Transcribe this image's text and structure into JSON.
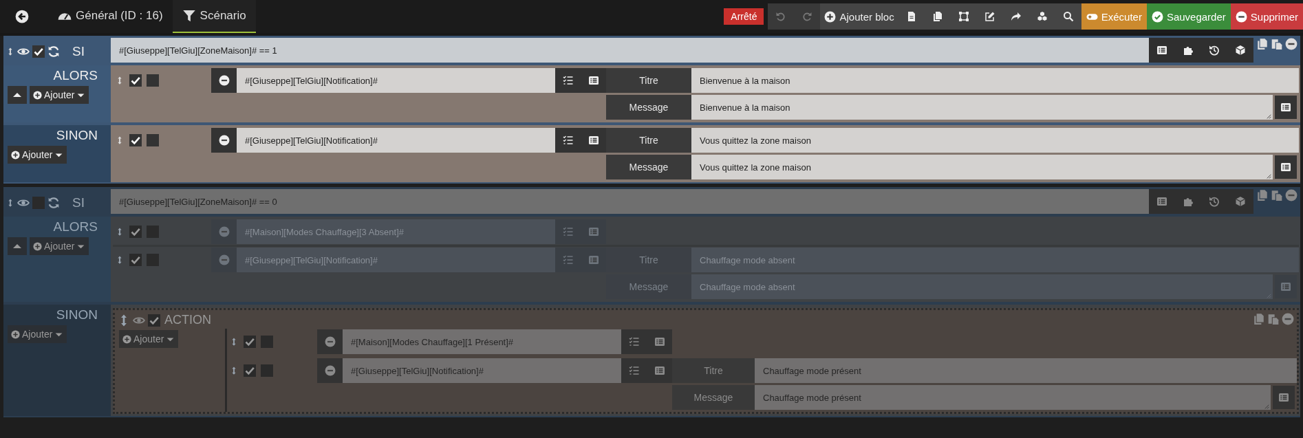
{
  "tabs": [
    {
      "kind": "general",
      "label": "Général (ID : 16)",
      "selected": false
    },
    {
      "kind": "scenario",
      "label": "Scénario",
      "selected": true
    }
  ],
  "status": "Arrêté",
  "history_buttons": [
    {
      "kind": "undo",
      "disabled": true
    },
    {
      "kind": "redo",
      "disabled": true
    }
  ],
  "add_block": "Ajouter bloc",
  "main_buttons": [
    {
      "kind": "execute",
      "label": "Exécuter"
    },
    {
      "kind": "save",
      "label": "Sauvegarder"
    },
    {
      "kind": "delete",
      "label": "Supprimer"
    }
  ],
  "blocks": [
    {
      "kind": "if",
      "keyword": "SI",
      "enabled": true,
      "condition": "#[Giuseppe][TelGiu][ZoneMaison]# == 1",
      "branches": [
        {
          "kind": "then",
          "label": "ALORS",
          "collapse_button": true,
          "add_label": "Ajouter",
          "items": [
            {
              "kind": "action",
              "enabled": true,
              "parallel": false,
              "expression": "#[Giuseppe][TelGiu][Notification]#",
              "options": [
                {
                  "kind": "line",
                  "label": "Titre",
                  "value": "Bienvenue à la maison"
                },
                {
                  "kind": "text",
                  "label": "Message",
                  "value": "Bienvenue à la maison"
                }
              ]
            }
          ]
        },
        {
          "kind": "else",
          "label": "SINON",
          "collapse_button": false,
          "add_label": "Ajouter",
          "items": [
            {
              "kind": "action",
              "enabled": true,
              "parallel": false,
              "expression": "#[Giuseppe][TelGiu][Notification]#",
              "options": [
                {
                  "kind": "line",
                  "label": "Titre",
                  "value": "Vous quittez la zone maison"
                },
                {
                  "kind": "text",
                  "label": "Message",
                  "value": "Vous quittez la zone maison"
                }
              ]
            }
          ]
        }
      ]
    },
    {
      "kind": "if",
      "keyword": "SI",
      "enabled": false,
      "condition": "#[Giuseppe][TelGiu][ZoneMaison]# == 0",
      "branches": [
        {
          "kind": "then",
          "label": "ALORS",
          "collapse_button": true,
          "add_label": "Ajouter",
          "items": [
            {
              "kind": "action",
              "enabled": true,
              "parallel": false,
              "expression": "#[Maison][Modes Chauffage][3 Absent]#"
            },
            {
              "kind": "action",
              "enabled": true,
              "parallel": false,
              "expression": "#[Giuseppe][TelGiu][Notification]#",
              "options": [
                {
                  "kind": "line",
                  "label": "Titre",
                  "value": "Chauffage mode absent"
                },
                {
                  "kind": "text",
                  "label": "Message",
                  "value": "Chauffage mode absent"
                }
              ]
            }
          ]
        },
        {
          "kind": "else",
          "label": "SINON",
          "collapse_button": false,
          "add_label": "Ajouter",
          "items": [
            {
              "kind": "block",
              "keyword": "ACTION",
              "enabled": true,
              "add_label": "Ajouter",
              "items": [
                {
                  "kind": "action",
                  "enabled": true,
                  "parallel": false,
                  "expression": "#[Maison][Modes Chauffage][1 Présent]#"
                },
                {
                  "kind": "action",
                  "enabled": true,
                  "parallel": false,
                  "expression": "#[Giuseppe][TelGiu][Notification]#",
                  "options": [
                    {
                      "kind": "line",
                      "label": "Titre",
                      "value": "Chauffage mode présent"
                    },
                    {
                      "kind": "text",
                      "label": "Message",
                      "value": "Chauffage mode présent"
                    }
                  ]
                }
              ]
            }
          ]
        }
      ]
    }
  ]
}
